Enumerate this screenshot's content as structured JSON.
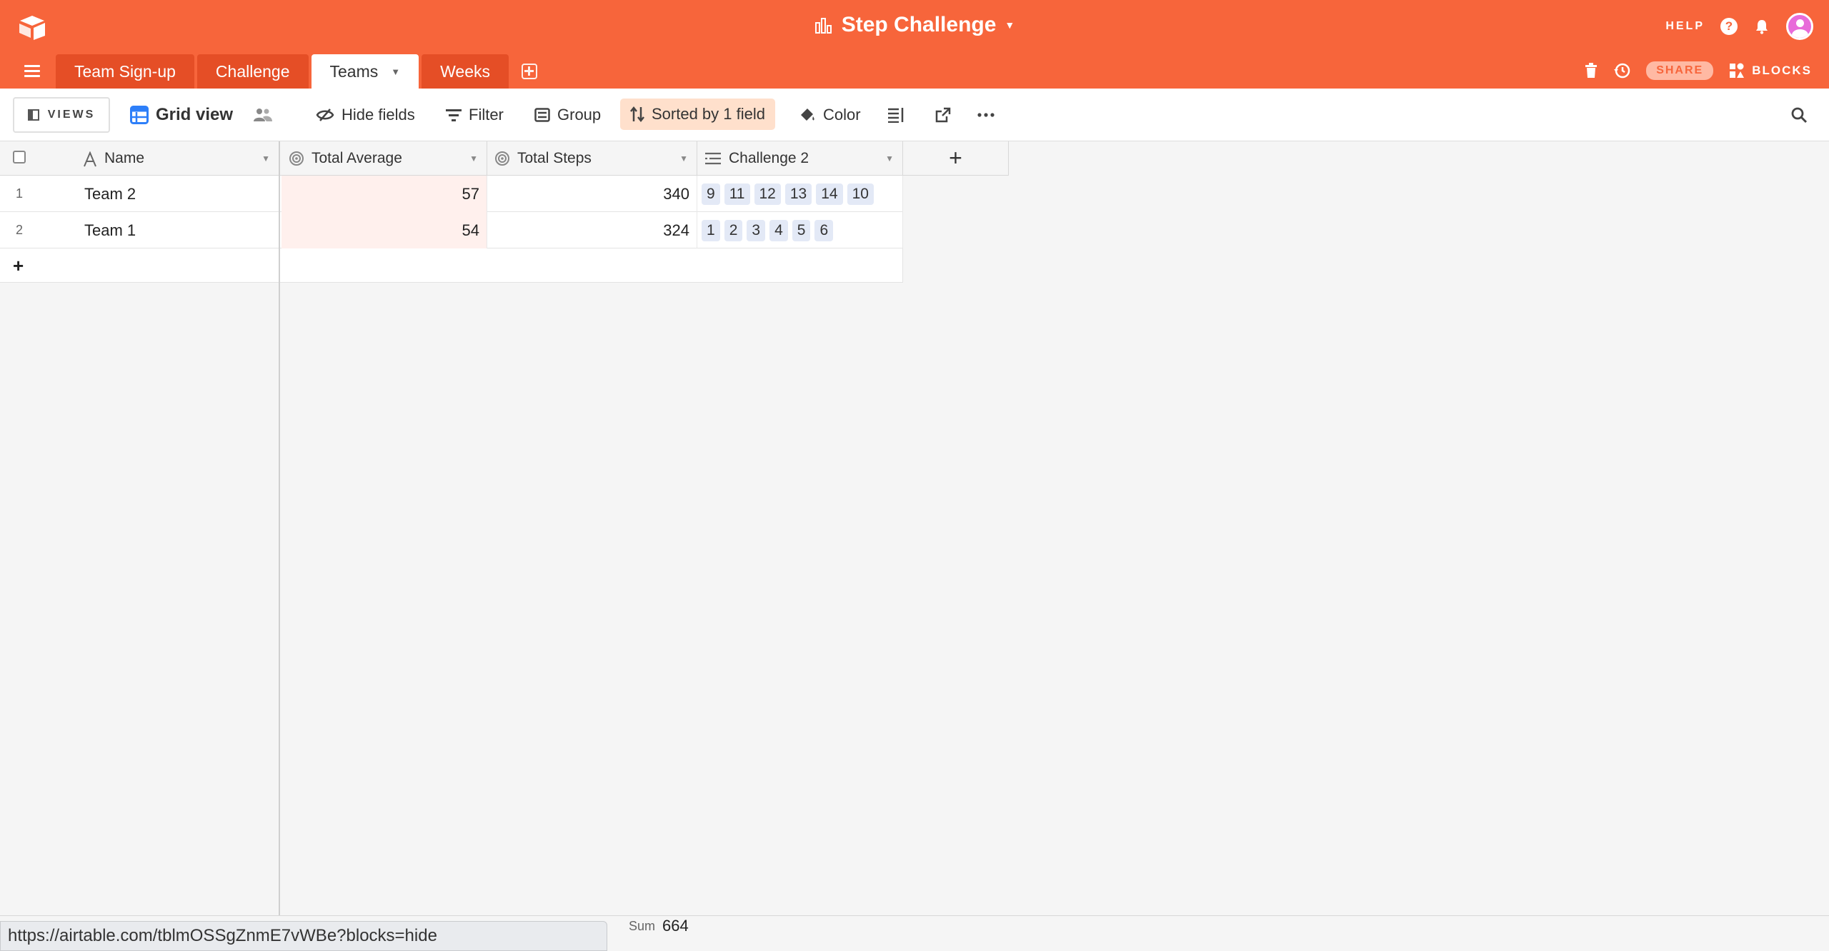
{
  "header": {
    "base_title": "Step Challenge",
    "help_label": "HELP",
    "help_glyph": "?",
    "share_label": "SHARE",
    "blocks_label": "BLOCKS",
    "accent_color": "#f7653b"
  },
  "tabs": [
    {
      "label": "Team Sign-up"
    },
    {
      "label": "Challenge"
    },
    {
      "label": "Teams",
      "active": true
    },
    {
      "label": "Weeks"
    }
  ],
  "toolbar": {
    "views_label": "VIEWS",
    "view_name": "Grid view",
    "hide_fields": "Hide fields",
    "filter": "Filter",
    "group": "Group",
    "sorted": "Sorted by 1 field",
    "color": "Color"
  },
  "columns": {
    "name": "Name",
    "total_average": "Total Average",
    "total_steps": "Total Steps",
    "challenge": "Challenge 2"
  },
  "rows": [
    {
      "num": "1",
      "name": "Team 2",
      "avg": "57",
      "steps": "340",
      "chips": [
        "9",
        "11",
        "12",
        "13",
        "14",
        "10"
      ]
    },
    {
      "num": "2",
      "name": "Team 1",
      "avg": "54",
      "steps": "324",
      "chips": [
        "1",
        "2",
        "3",
        "4",
        "5",
        "6"
      ]
    }
  ],
  "add_row_glyph": "+",
  "add_field_glyph": "+",
  "footer": {
    "sum_label": "Sum",
    "sum_value": "664"
  },
  "status_url": "https://airtable.com/tblmOSSgZnmE7vWBe?blocks=hide"
}
